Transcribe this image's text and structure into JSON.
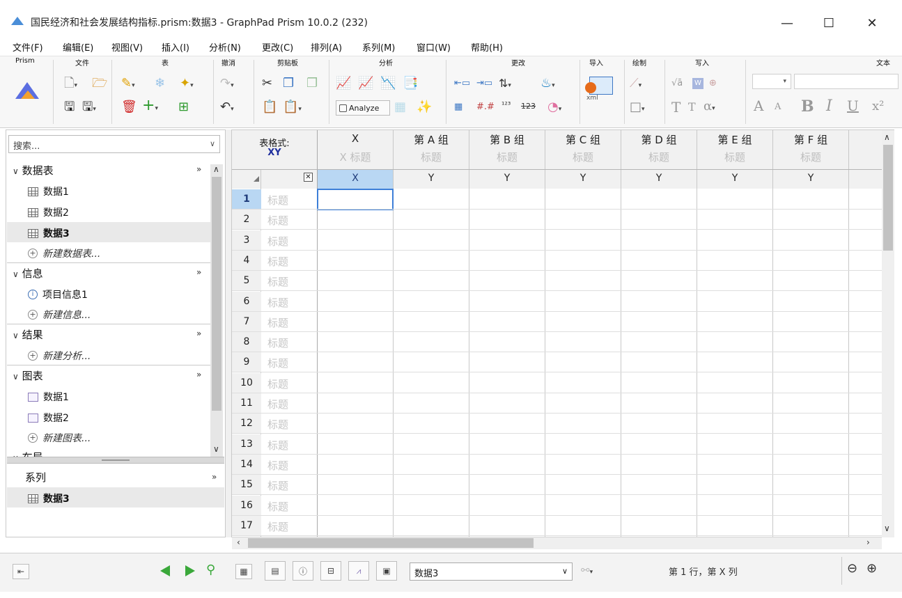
{
  "window": {
    "title": "国民经济和社会发展结构指标.prism:数据3 - GraphPad Prism 10.0.2 (232)",
    "minimize": "—",
    "maximize": "☐",
    "close": "✕"
  },
  "menu": [
    "文件(F)",
    "编辑(E)",
    "视图(V)",
    "插入(I)",
    "分析(N)",
    "更改(C)",
    "排列(A)",
    "系列(M)",
    "窗口(W)",
    "帮助(H)"
  ],
  "ribbon": {
    "groups": [
      "Prism",
      "文件",
      "表",
      "撤消",
      "剪贴板",
      "分析",
      "更改",
      "导入",
      "绘制",
      "写入",
      "文本"
    ],
    "analyze_label": "Analyze",
    "import_label": "xml",
    "text_tools": [
      "A",
      "A",
      "B",
      "I",
      "U",
      "x²"
    ]
  },
  "sidebar": {
    "search_placeholder": "搜索...",
    "sections": {
      "data_tables": "数据表",
      "info": "信息",
      "results": "结果",
      "graphs": "图表",
      "layouts": "布局"
    },
    "data_items": [
      "数据1",
      "数据2",
      "数据3"
    ],
    "new_data": "新建数据表...",
    "info_items": [
      "项目信息1"
    ],
    "new_info": "新建信息...",
    "new_analysis": "新建分析...",
    "graph_items": [
      "数据1",
      "数据2"
    ],
    "new_graph": "新建图表...",
    "family_label": "系列",
    "family_items": [
      "数据3"
    ],
    "expand": "»"
  },
  "grid": {
    "format_label": "表格式:",
    "format_value": "XY",
    "columns": [
      {
        "header": "X",
        "subtitle": "X 标题",
        "type": "X"
      },
      {
        "header": "第 A 组",
        "subtitle": "标题",
        "type": "Y"
      },
      {
        "header": "第 B 组",
        "subtitle": "标题",
        "type": "Y"
      },
      {
        "header": "第 C 组",
        "subtitle": "标题",
        "type": "Y"
      },
      {
        "header": "第 D 组",
        "subtitle": "标题",
        "type": "Y"
      },
      {
        "header": "第 E 组",
        "subtitle": "标题",
        "type": "Y"
      },
      {
        "header": "第 F 组",
        "subtitle": "标题",
        "type": "Y"
      },
      {
        "header": "第",
        "subtitle": "标",
        "type": ""
      }
    ],
    "row_title_placeholder": "标题",
    "rows": [
      "1",
      "2",
      "3",
      "4",
      "5",
      "6",
      "7",
      "8",
      "9",
      "10",
      "11",
      "12",
      "13",
      "14",
      "15",
      "16",
      "17"
    ]
  },
  "status": {
    "sheet": "数据3",
    "position": "第 1 行，第 X 列"
  }
}
